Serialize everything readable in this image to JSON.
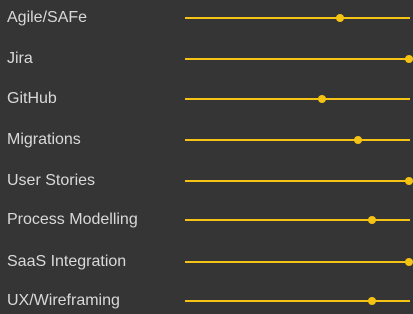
{
  "accent_color": "#f5c313",
  "skills": [
    {
      "label": "Agile/SAFe",
      "level": 0.69
    },
    {
      "label": "Jira",
      "level": 1.0
    },
    {
      "label": "GitHub",
      "level": 0.61
    },
    {
      "label": "Migrations",
      "level": 0.77
    },
    {
      "label": "User Stories",
      "level": 1.0
    },
    {
      "label": "Process Modelling",
      "level": 0.83
    },
    {
      "label": "SaaS Integration",
      "level": 1.0
    },
    {
      "label": "UX/Wireframing",
      "level": 0.83
    }
  ]
}
